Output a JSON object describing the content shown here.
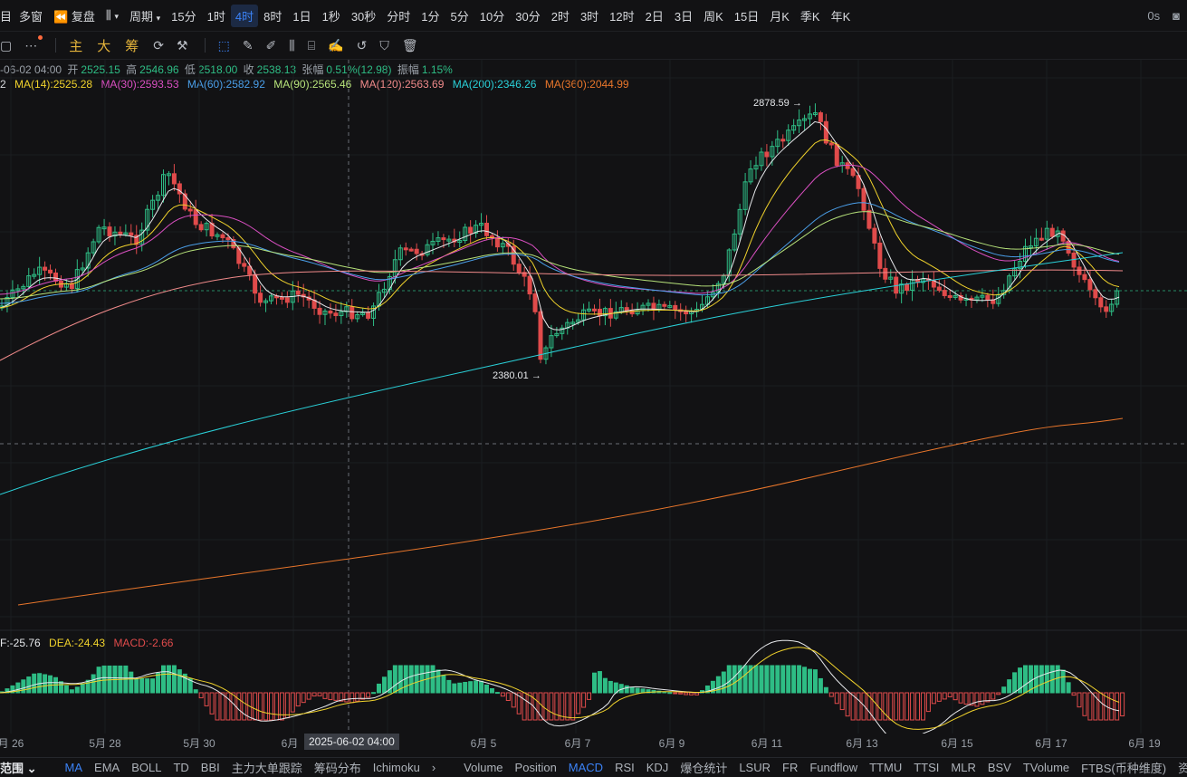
{
  "toolbar": {
    "items": [
      "目",
      "多窗",
      "复盘",
      "周期",
      "15分",
      "1时",
      "4时",
      "8时",
      "1日",
      "1秒",
      "30秒",
      "分时",
      "1分",
      "5分",
      "10分",
      "30分",
      "2时",
      "3时",
      "12时",
      "2日",
      "3日",
      "周K",
      "15日",
      "月K",
      "季K",
      "年K"
    ],
    "active": "4时",
    "countdown": "0s"
  },
  "drawbar": {
    "cn": [
      "主",
      "大",
      "筹"
    ]
  },
  "ohlc": {
    "time": "-06-02 04:00",
    "open_label": "开",
    "open": "2525.15",
    "high_label": "高",
    "high": "2546.96",
    "low_label": "低",
    "low": "2518.00",
    "close_label": "收",
    "close": "2538.13",
    "change_label": "张幅",
    "change": "0.51%(12.98)",
    "amp_label": "振幅",
    "amp": "1.15%"
  },
  "ma_legend": [
    {
      "text": "2",
      "color": "#d7d9dd"
    },
    {
      "text": "MA(14):2525.28",
      "color": "#f0d22c"
    },
    {
      "text": "MA(30):2593.53",
      "color": "#d94fc1"
    },
    {
      "text": "MA(60):2582.92",
      "color": "#4a9ee8"
    },
    {
      "text": "MA(90):2565.46",
      "color": "#b6e27a"
    },
    {
      "text": "MA(120):2563.69",
      "color": "#f08a8a"
    },
    {
      "text": "MA(200):2346.26",
      "color": "#2ad0d8"
    },
    {
      "text": "MA(360):2044.99",
      "color": "#e8762b"
    }
  ],
  "chart": {
    "high_label": "2878.59",
    "low_label": "2380.01",
    "colors": {
      "up": "#2ebd85",
      "down": "#e04b4b",
      "bg": "#121214",
      "grid": "#1d1f23"
    }
  },
  "macd_legend": [
    {
      "text": "F:-25.76",
      "color": "#e6e8eb"
    },
    {
      "text": "DEA:-24.43",
      "color": "#f0d22c"
    },
    {
      "text": "MACD:-2.66",
      "color": "#e04b4b"
    }
  ],
  "dates": [
    "月 26",
    "5月 28",
    "5月 30",
    "6月",
    "6月 5",
    "6月 7",
    "6月 9",
    "6月 11",
    "6月 13",
    "6月 15",
    "6月 17",
    "6月 19"
  ],
  "crosshair_date": "2025-06-02 04:00",
  "bottom": {
    "range": "范围",
    "main": [
      "MA",
      "EMA",
      "BOLL",
      "TD",
      "BBI",
      "主力大单跟踪",
      "筹码分布",
      "Ichimoku"
    ],
    "sub": [
      "Volume",
      "Position",
      "MACD",
      "RSI",
      "KDJ",
      "爆仓统计",
      "LSUR",
      "FR",
      "Fundflow",
      "TTMU",
      "TTSI",
      "MLR",
      "BSV",
      "TVolume",
      "FTBS(币种维度)",
      "资金流"
    ],
    "active_main": "MA",
    "active_sub": "MACD"
  }
}
